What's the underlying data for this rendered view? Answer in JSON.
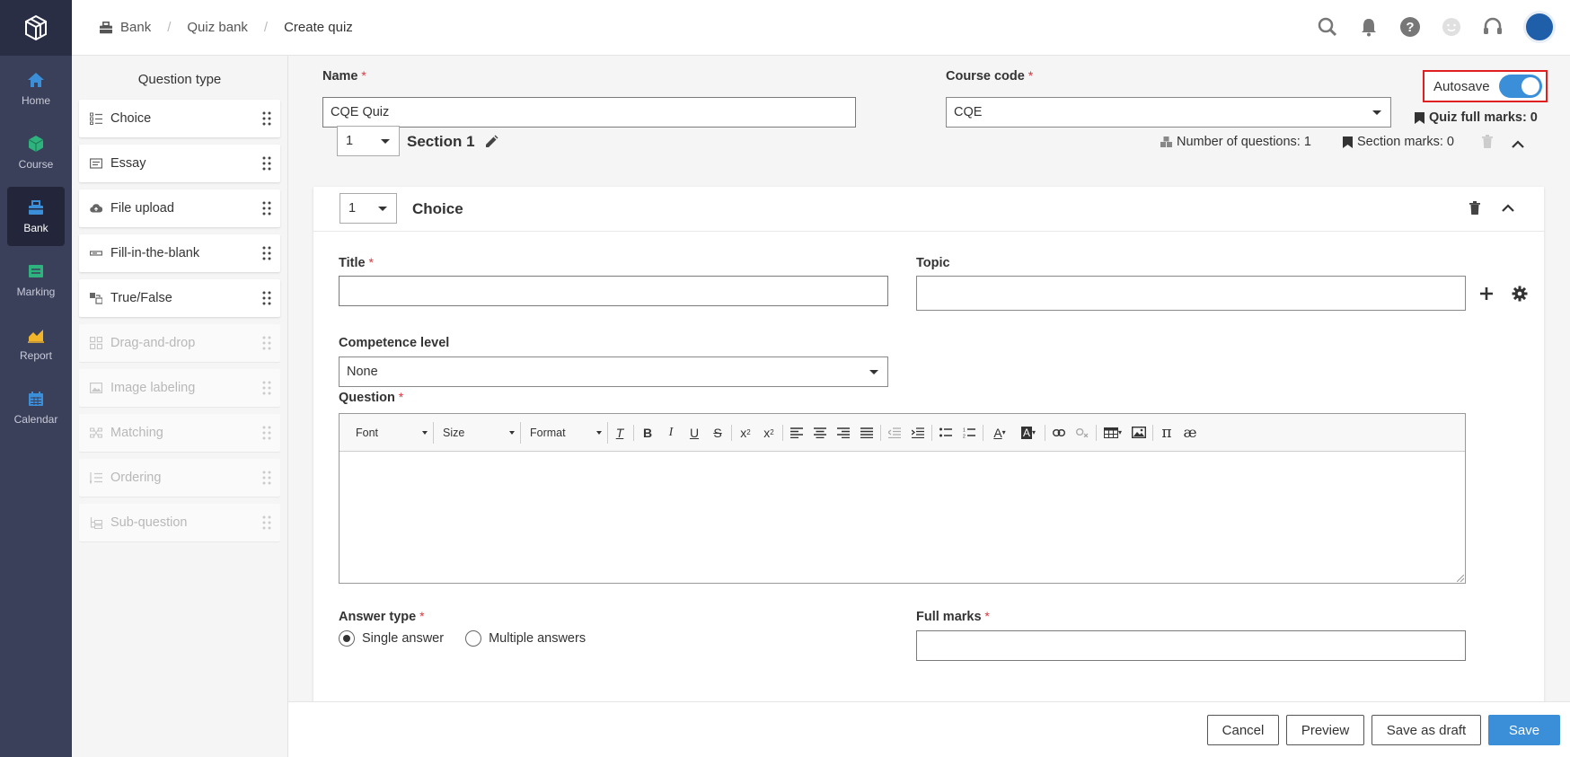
{
  "nav": {
    "items": [
      {
        "label": "Home",
        "icon": "home-icon"
      },
      {
        "label": "Course",
        "icon": "cube-icon"
      },
      {
        "label": "Bank",
        "icon": "bank-icon",
        "active": true
      },
      {
        "label": "Marking",
        "icon": "marking-icon"
      },
      {
        "label": "Report",
        "icon": "chart-icon"
      },
      {
        "label": "Calendar",
        "icon": "calendar-icon"
      }
    ]
  },
  "breadcrumb": {
    "items": [
      "Bank",
      "Quiz bank",
      "Create quiz"
    ]
  },
  "question_types": {
    "title": "Question type",
    "items": [
      {
        "label": "Choice",
        "enabled": true
      },
      {
        "label": "Essay",
        "enabled": true
      },
      {
        "label": "File upload",
        "enabled": true
      },
      {
        "label": "Fill-in-the-blank",
        "enabled": true
      },
      {
        "label": "True/False",
        "enabled": true
      },
      {
        "label": "Drag-and-drop",
        "enabled": false
      },
      {
        "label": "Image labeling",
        "enabled": false
      },
      {
        "label": "Matching",
        "enabled": false
      },
      {
        "label": "Ordering",
        "enabled": false
      },
      {
        "label": "Sub-question",
        "enabled": false
      }
    ]
  },
  "form": {
    "name_label": "Name",
    "name_value": "CQE Quiz",
    "course_code_label": "Course code",
    "course_code_value": "CQE",
    "required_mark": "*",
    "autosave_label": "Autosave",
    "autosave_on": true,
    "quiz_full_marks": "Quiz full marks: 0"
  },
  "section": {
    "number": "1",
    "title": "Section 1",
    "num_questions": "Number of questions: 1",
    "section_marks": "Section marks: 0"
  },
  "question": {
    "number": "1",
    "type": "Choice",
    "title_label": "Title",
    "topic_label": "Topic",
    "competence_label": "Competence level",
    "competence_value": "None",
    "question_label": "Question",
    "toolbar": {
      "font": "Font",
      "size": "Size",
      "format": "Format"
    },
    "answer_type_label": "Answer type",
    "answer_options": [
      "Single answer",
      "Multiple answers"
    ],
    "full_marks_label": "Full marks"
  },
  "footer": {
    "cancel": "Cancel",
    "preview": "Preview",
    "save_draft": "Save as draft",
    "save": "Save"
  },
  "colors": {
    "accent": "#3b8fd9",
    "nav_bg": "#3a3f5a",
    "required": "#d9363e",
    "highlight_border": "#e02020"
  }
}
